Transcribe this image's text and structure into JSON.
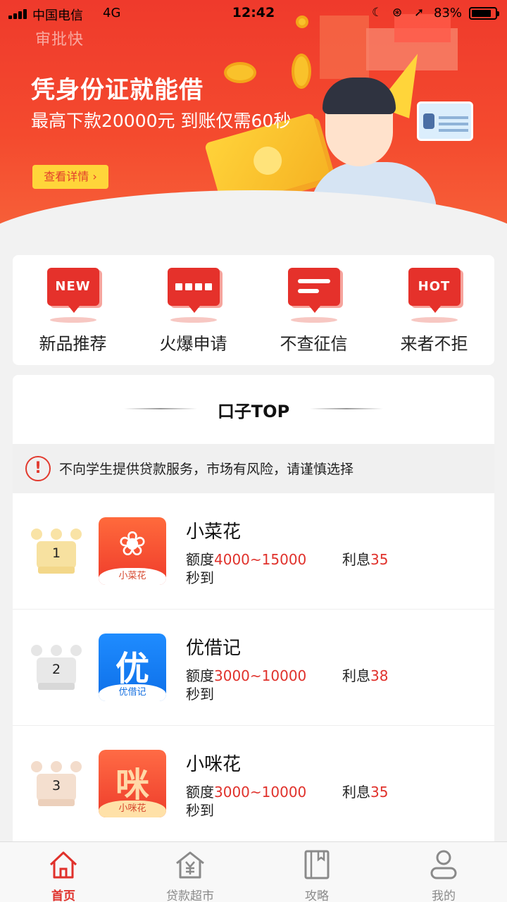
{
  "status_bar": {
    "carrier": "中国电信",
    "network": "4G",
    "time": "12:42",
    "battery_percent": "83%",
    "battery_level": 0.83,
    "icons": [
      "signal-icon",
      "moon-icon",
      "rotation-lock-icon",
      "location-icon",
      "battery-icon"
    ]
  },
  "banner": {
    "brand": "审批快",
    "headline": "凭身份证就能借",
    "subline": "最高下款20000元 到账仅需60秒",
    "button_label": "查看详情 ›"
  },
  "categories": [
    {
      "icon_text": "NEW",
      "label": "新品推荐"
    },
    {
      "icon_text": "",
      "label": "火爆申请"
    },
    {
      "icon_text": "",
      "label": "不查征信"
    },
    {
      "icon_text": "HOT",
      "label": "来者不拒"
    }
  ],
  "top_section": {
    "title": "口子TOP",
    "notice": "不向学生提供贷款服务，市场有风险，请谨慎选择"
  },
  "products": [
    {
      "rank": "1",
      "name": "小菜花",
      "icon_caption": "小菜花",
      "icon_glyph": "❀",
      "limit_label": "额度",
      "limit": "4000~15000",
      "rate_label": "利息",
      "rate": "35",
      "speed": "秒到"
    },
    {
      "rank": "2",
      "name": "优借记",
      "icon_caption": "优借记",
      "icon_glyph": "优",
      "limit_label": "额度",
      "limit": "3000~10000",
      "rate_label": "利息",
      "rate": "38",
      "speed": "秒到"
    },
    {
      "rank": "3",
      "name": "小咪花",
      "icon_caption": "小咪花",
      "icon_glyph": "咪",
      "limit_label": "额度",
      "limit": "3000~10000",
      "rate_label": "利息",
      "rate": "35",
      "speed": "秒到"
    }
  ],
  "tabbar": [
    {
      "label": "首页",
      "icon": "home-icon",
      "active": true
    },
    {
      "label": "贷款超市",
      "icon": "loan-market-icon",
      "active": false
    },
    {
      "label": "攻略",
      "icon": "guide-book-icon",
      "active": false
    },
    {
      "label": "我的",
      "icon": "profile-icon",
      "active": false
    }
  ],
  "colors": {
    "accent": "#e0312b",
    "banner": "#f44a2e",
    "button": "#ffd53a"
  }
}
